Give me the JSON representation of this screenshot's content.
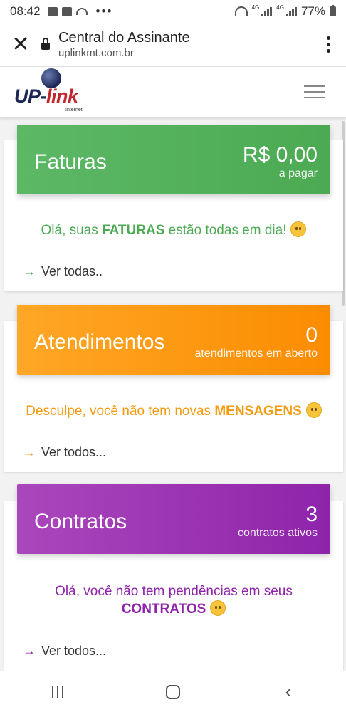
{
  "status_bar": {
    "time": "08:42",
    "dots": "•••",
    "net_label_1": "4G",
    "net_label_2": "4G",
    "battery": "77%"
  },
  "browser": {
    "close_icon": "✕",
    "title": "Central do Assinante",
    "url": "uplinkmt.com.br"
  },
  "site": {
    "logo_up": "UP-",
    "logo_link": "link",
    "logo_tagline": "Internet"
  },
  "cards": [
    {
      "title": "Faturas",
      "value": "R$ 0,00",
      "sub": "a pagar",
      "msg_before": "Olá, suas ",
      "msg_bold": "FATURAS",
      "msg_after": " estão todas em dia!",
      "link": "Ver todas.."
    },
    {
      "title": "Atendimentos",
      "value": "0",
      "sub": "atendimentos em aberto",
      "msg_before": "Desculpe, você não tem novas ",
      "msg_bold": "MENSAGENS",
      "msg_after": "",
      "link": "Ver todos..."
    },
    {
      "title": "Contratos",
      "value": "3",
      "sub": "contratos ativos",
      "msg_before": "Olá, você não tem pendências em seus",
      "msg_bold": "CONTRATOS",
      "msg_after": "",
      "link": "Ver todos..."
    }
  ],
  "arrow": "→",
  "nav": {
    "back": "‹"
  },
  "colors": {
    "faturas": "#4caa53",
    "atendimentos": "#fb8c00",
    "contratos": "#8e24aa"
  }
}
